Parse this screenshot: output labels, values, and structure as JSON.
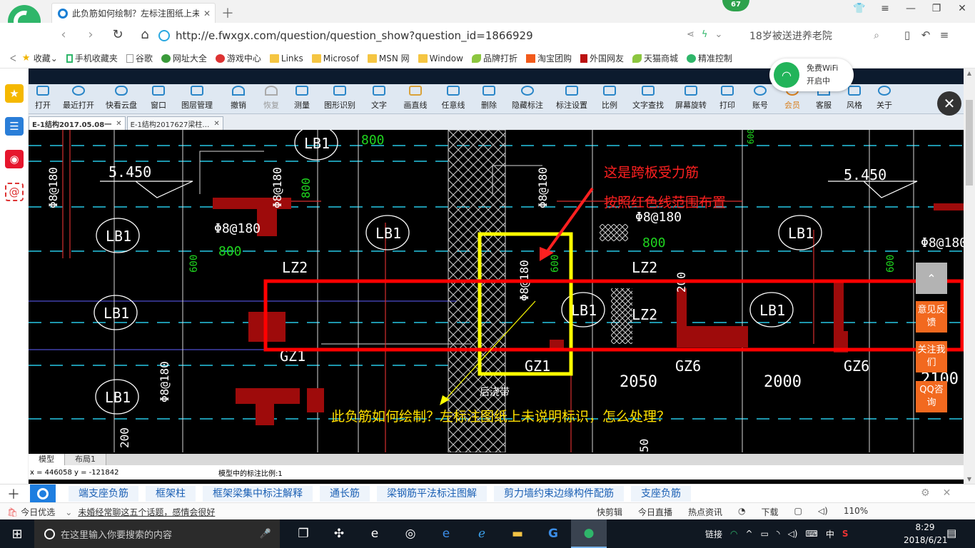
{
  "browser": {
    "tab_title": "此负筋如何绘制？左标注图纸上未",
    "badge": "67",
    "url": "http://e.fwxgx.com/question/question_show?question_id=1866929",
    "search_text": "18岁被送进养老院",
    "bookmarks": [
      "收藏",
      "手机收藏夹",
      "谷歌",
      "网址大全",
      "游戏中心",
      "Links",
      "Microsof",
      "MSN 网",
      "Window",
      "品牌打折",
      "淘宝团购",
      "外国网友",
      "天猫商城",
      "精准控制"
    ],
    "wifi_title": "免费WiFi",
    "wifi_status": "开启中"
  },
  "app": {
    "toolbar": [
      "打开",
      "最近打开",
      "快看云盘",
      "窗口",
      "图层管理",
      "撤销",
      "恢复",
      "测量",
      "图形识别",
      "文字",
      "画直线",
      "任意线",
      "删除",
      "隐藏标注",
      "标注设置",
      "比例",
      "文字查找",
      "屏幕旋转",
      "打印",
      "账号",
      "会员",
      "客服",
      "风格",
      "关于"
    ],
    "doc_tabs": [
      "E-1结构2017.05.08一",
      "E-1结构2017627梁柱…"
    ],
    "layout_tabs": [
      "模型",
      "布局1"
    ],
    "status_coords": "x = 446058  y = -121842",
    "status_scale": "模型中的标注比例:1",
    "drawing": {
      "annotation_top_1": "这是跨板受力筋",
      "annotation_top_2": "按照红色线范围布置",
      "question": "此负筋如何绘制？左标注图纸上未说明标识，怎么处理？",
      "labels": [
        "5.450",
        "5.450",
        "Φ8@180",
        "Φ8@180",
        "Φ8@180",
        "Φ8@180",
        "Φ8@180",
        "Φ8@180",
        "Φ8@180",
        "Φ8@180",
        "800",
        "800",
        "800",
        "800",
        "600",
        "600",
        "600",
        "600",
        "LB1",
        "LB1",
        "LB1",
        "LB1",
        "LB1",
        "LB1",
        "LB1",
        "LB1",
        "LZ2",
        "LZ2",
        "LZ2",
        "GZ1",
        "GZ1",
        "GZ6",
        "GZ6",
        "2050",
        "2000",
        "2100",
        "后浇带",
        "200",
        "200",
        "50"
      ]
    }
  },
  "float_buttons": [
    "意见反馈",
    "关注我们",
    "QQ咨询"
  ],
  "related": [
    "端支座负筋",
    "框架柱",
    "框架梁集中标注解释",
    "通长筋",
    "梁钢筋平法标注图解",
    "剪力墙约束边缘构件配筋",
    "支座负筋"
  ],
  "status": {
    "left": "今日优选",
    "headline": "未婚经常聊这五个话题，感情会很好",
    "right": [
      "快剪辑",
      "今日直播",
      "热点资讯",
      "下载",
      "110%"
    ]
  },
  "taskbar": {
    "search_placeholder": "在这里输入你要搜索的内容",
    "tray": [
      "链接",
      "中"
    ],
    "time": "8:29",
    "date": "2018/6/21"
  }
}
